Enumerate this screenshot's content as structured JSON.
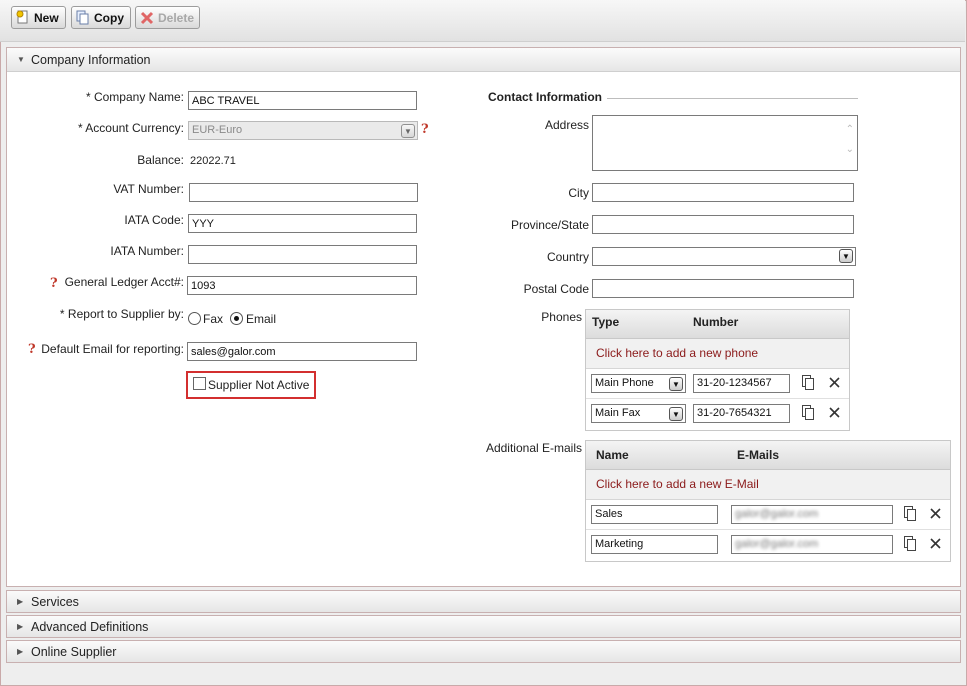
{
  "toolbar": {
    "new_label": "New",
    "copy_label": "Copy",
    "delete_label": "Delete"
  },
  "company_section": {
    "title": "Company Information"
  },
  "form": {
    "company_name_label": "* Company Name:",
    "company_name_value": "ABC TRAVEL",
    "account_currency_label": "* Account Currency:",
    "account_currency_value": "EUR-Euro",
    "balance_label": "Balance:",
    "balance_value": "22022.71",
    "vat_label": "VAT Number:",
    "vat_value": "",
    "iata_code_label": "IATA Code:",
    "iata_code_value": "YYY",
    "iata_number_label": "IATA Number:",
    "iata_number_value": "",
    "gl_label": "General Ledger Acct#:",
    "gl_value": "1093",
    "report_label": "* Report to Supplier by:",
    "report_fax": "Fax",
    "report_email": "Email",
    "report_selected": "Email",
    "default_email_label": "Default Email for reporting:",
    "default_email_value": "sales@galor.com",
    "not_active_label": "Supplier Not Active"
  },
  "contact": {
    "title": "Contact Information",
    "address_label": "Address",
    "city_label": "City",
    "province_label": "Province/State",
    "country_label": "Country",
    "postal_label": "Postal Code",
    "phones_label": "Phones",
    "phones_col_type": "Type",
    "phones_col_number": "Number",
    "phones_add": "Click here to add a new phone",
    "phones": [
      {
        "type": "Main Phone",
        "number": "31-20-1234567"
      },
      {
        "type": "Main Fax",
        "number": "31-20-7654321"
      }
    ],
    "emails_label": "Additional E-mails",
    "emails_col_name": "Name",
    "emails_col_email": "E-Mails",
    "emails_add": "Click here to add a new E-Mail",
    "emails": [
      {
        "name": "Sales",
        "email": "galor@galor.com"
      },
      {
        "name": "Marketing",
        "email": "galor@galor.com"
      }
    ]
  },
  "sections": {
    "services": "Services",
    "advanced": "Advanced Definitions",
    "online": "Online Supplier"
  },
  "colors": {
    "accent_red": "#c62828",
    "link_red": "#8b1a1a"
  }
}
